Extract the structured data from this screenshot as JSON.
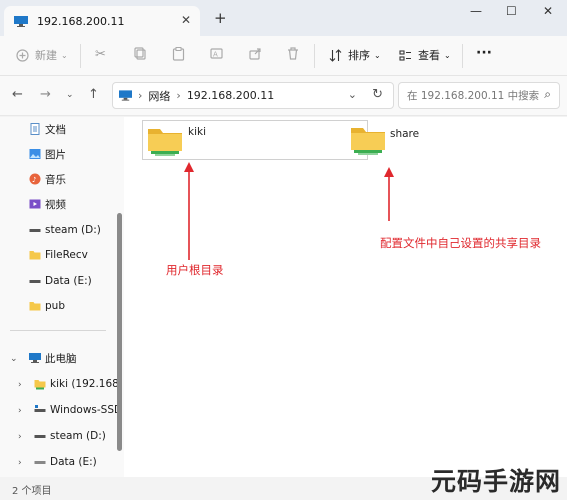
{
  "tab": {
    "title": "192.168.200.11",
    "close": "✕",
    "new": "+"
  },
  "window": {
    "minimize": "—",
    "maximize": "☐",
    "close": "✕"
  },
  "toolbar": {
    "new_label": "新建",
    "sort_label": "排序",
    "view_label": "查看",
    "more_label": "···"
  },
  "address": {
    "segments": [
      "网络",
      "192.168.200.11"
    ],
    "search_placeholder": "在 192.168.200.11 中搜索"
  },
  "sidebar": {
    "quick_access": [
      {
        "label": "文档",
        "pinned": true
      },
      {
        "label": "图片",
        "pinned": true
      },
      {
        "label": "音乐",
        "pinned": true
      },
      {
        "label": "视频",
        "pinned": true
      },
      {
        "label": "steam (D:)"
      },
      {
        "label": "FileRecv"
      },
      {
        "label": "Data (E:)"
      },
      {
        "label": "pub"
      }
    ],
    "this_pc": "此电脑",
    "pc_items": [
      {
        "label": "kiki (192.168."
      },
      {
        "label": "Windows-SSD"
      },
      {
        "label": "steam (D:)"
      },
      {
        "label": "Data (E:)"
      }
    ]
  },
  "content": {
    "folders": [
      {
        "name": "kiki"
      },
      {
        "name": "share"
      }
    ],
    "annotations": {
      "left": "用户根目录",
      "right": "配置文件中自己设置的共享目录"
    }
  },
  "status": {
    "count": "2 个项目"
  },
  "watermark": "元码手游网",
  "colors": {
    "accent_red": "#e0282e",
    "folder_yellow": "#f5c84a",
    "folder_green": "#3cae52"
  }
}
